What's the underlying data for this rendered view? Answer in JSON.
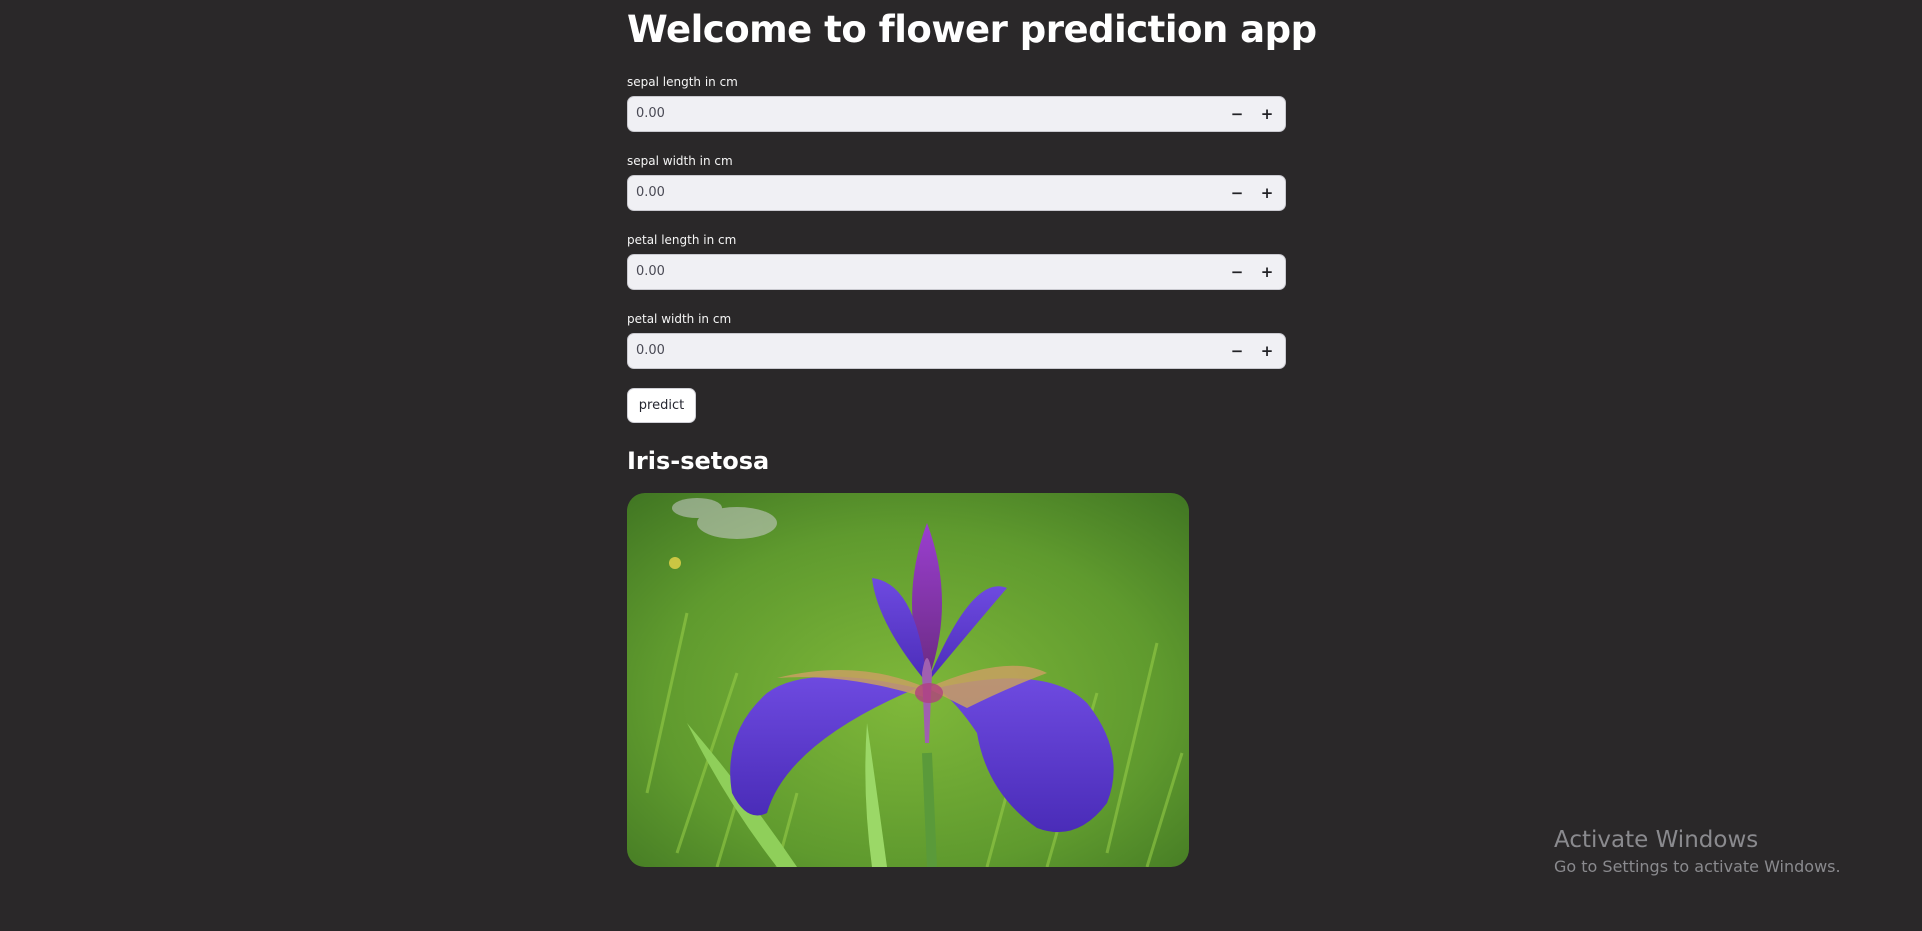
{
  "header": {
    "title": "Welcome to flower prediction app"
  },
  "inputs": [
    {
      "label": "sepal length in cm",
      "value": "0.00",
      "decrement": "−",
      "increment": "+"
    },
    {
      "label": "sepal width in cm",
      "value": "0.00",
      "decrement": "−",
      "increment": "+"
    },
    {
      "label": "petal length in cm",
      "value": "0.00",
      "decrement": "−",
      "increment": "+"
    },
    {
      "label": "petal width in cm",
      "value": "0.00",
      "decrement": "−",
      "increment": "+"
    }
  ],
  "actions": {
    "predict_label": "predict"
  },
  "result": {
    "prediction": "Iris-setosa",
    "image_subject": "iris-flower-photo"
  },
  "system": {
    "watermark_title": "Activate Windows",
    "watermark_subtitle": "Go to Settings to activate Windows."
  },
  "colors": {
    "background": "#2a2829",
    "input_background": "#f0f0f4",
    "flower_petal": "#5a35d0"
  }
}
